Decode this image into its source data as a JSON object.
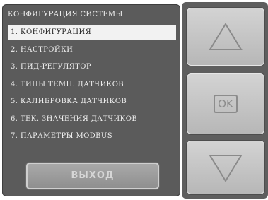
{
  "screen": {
    "title": "КОНФИГУРАЦИЯ СИСТЕМЫ",
    "menu": [
      {
        "label": "1. КОНФИГУРАЦИЯ",
        "selected": true
      },
      {
        "label": "2. НАСТРОЙКИ",
        "selected": false
      },
      {
        "label": "3. ПИД-РЕГУЛЯТОР",
        "selected": false
      },
      {
        "label": "4. ТИПЫ ТЕМП. ДАТЧИКОВ",
        "selected": false
      },
      {
        "label": "5. КАЛИБРОВКА ДАТЧИКОВ",
        "selected": false
      },
      {
        "label": "6. ТЕК. ЗНАЧЕНИЯ ДАТЧИКОВ",
        "selected": false
      },
      {
        "label": "7. ПАРАМЕТРЫ MODBUS",
        "selected": false
      }
    ],
    "exit_label": "ВЫХОД"
  },
  "side_buttons": {
    "up_icon": "triangle-up-icon",
    "ok_label": "OK",
    "down_icon": "triangle-down-icon"
  },
  "colors": {
    "panel": "#5b5b5b",
    "selection": "#f2f2f2",
    "button": "#c8c8c8"
  }
}
